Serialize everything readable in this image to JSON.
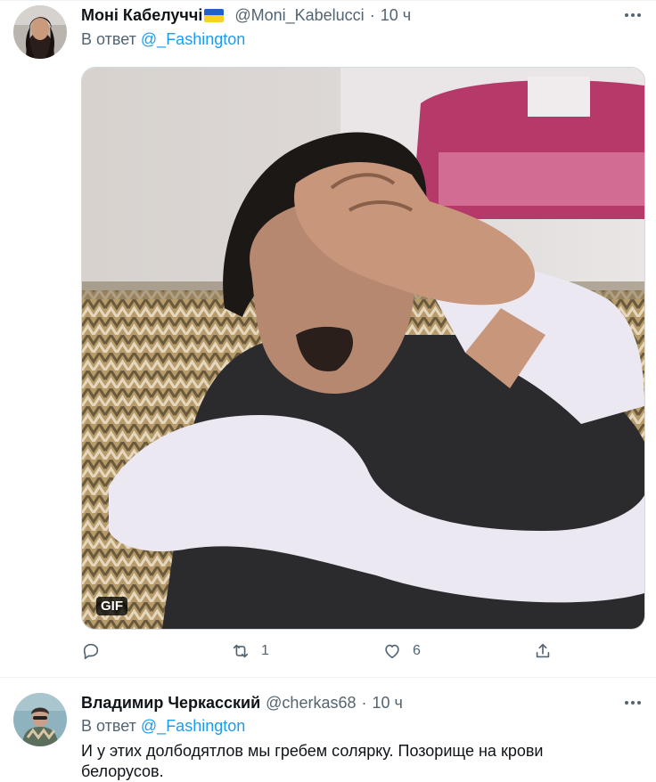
{
  "tweets": [
    {
      "name": "Моні Кабелуччі",
      "flag": "flag-ukraine-icon",
      "handle": "@Moni_Kabelucci",
      "time": "10 ч",
      "reply_prefix": "В ответ",
      "reply_to": "@_Fashington",
      "media_badge": "GIF",
      "retweets": "1",
      "likes": "6"
    },
    {
      "name": "Владимир Черкасский",
      "handle": "@cherkas68",
      "time": "10 ч",
      "reply_prefix": "В ответ",
      "reply_to": "@_Fashington",
      "text": "И у этих долбодятлов мы гребем солярку. Позорище на крови белорусов."
    }
  ],
  "colors": {
    "accent": "#1d9bf0",
    "secondary": "#536471",
    "divider": "#eff3f4"
  }
}
